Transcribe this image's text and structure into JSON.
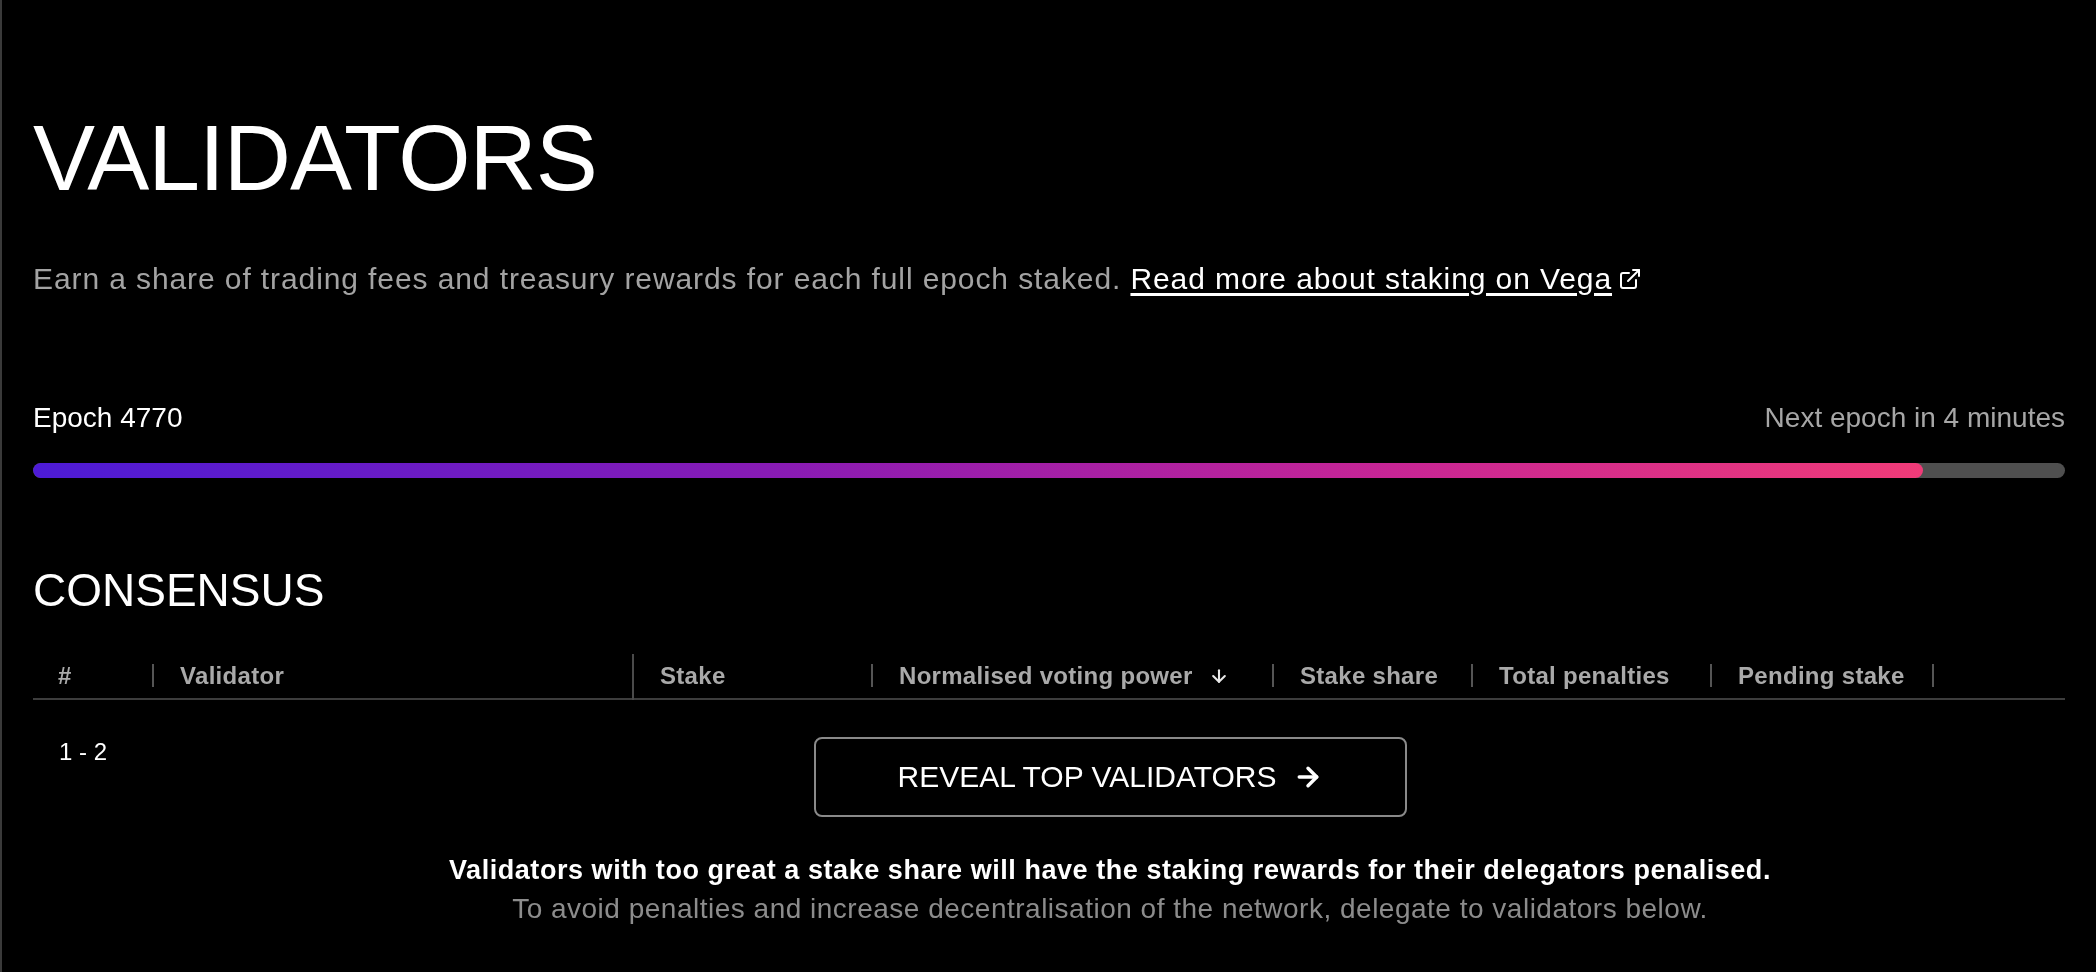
{
  "page": {
    "title": "VALIDATORS",
    "description": "Earn a share of trading fees and treasury rewards for each full epoch staked.",
    "link": {
      "label": "Read more about staking on Vega",
      "external": true
    }
  },
  "epoch": {
    "label": "Epoch 4770",
    "countdown": "Next epoch in 4 minutes",
    "level": 0.93
  },
  "consensus": {
    "title": "CONSENSUS",
    "table": {
      "columns": [
        {
          "label": "#",
          "pinned": false,
          "sorted": false
        },
        {
          "label": "Validator",
          "pinned": true,
          "sorted": false
        },
        {
          "label": "Stake",
          "pinned": false,
          "sorted": false
        },
        {
          "label": "Normalised voting power",
          "pinned": false,
          "sorted": true
        },
        {
          "label": "Stake share",
          "pinned": false,
          "sorted": false
        },
        {
          "label": "Total penalties",
          "pinned": false,
          "sorted": false
        },
        {
          "label": "Pending stake",
          "pinned": false,
          "sorted": false
        }
      ]
    },
    "group": {
      "rank": "1 - 2",
      "button": "REVEAL TOP VALIDATORS",
      "headline": "Validators with too great a stake share will have the staking rewards for their delegators penalised.",
      "detail": "To avoid penalties and increase decentralisation of the network, delegate to validators below."
    }
  }
}
